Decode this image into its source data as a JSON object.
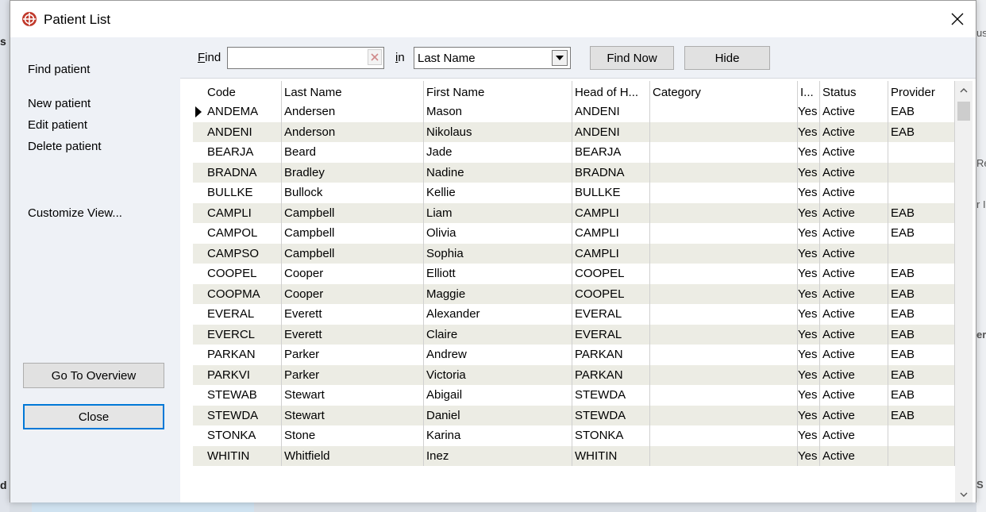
{
  "background": {
    "left_items": [
      "s",
      "d"
    ],
    "right_items": [
      "us",
      "Re",
      "r I",
      "er",
      "S"
    ]
  },
  "dialog": {
    "title": "Patient List"
  },
  "sidebar": {
    "find_patient": "Find patient",
    "new_patient": "New patient",
    "edit_patient": "Edit patient",
    "delete_patient": "Delete patient",
    "customize_view": "Customize View...",
    "go_to_overview": "Go To Overview",
    "close": "Close"
  },
  "findbar": {
    "find_label_u": "F",
    "find_label_rest": "ind",
    "find_value": "",
    "in_label_u": "i",
    "in_label_rest": "n",
    "in_selected": "Last Name",
    "find_now": "Find Now",
    "hide": "Hide"
  },
  "grid": {
    "columns": [
      "Code",
      "Last Name",
      "First Name",
      "Head of H...",
      "Category",
      "I...",
      "Status",
      "Provider"
    ],
    "rows": [
      [
        "ANDEMA",
        "Andersen",
        "Mason",
        "ANDENI",
        "",
        "Yes",
        "Active",
        "EAB"
      ],
      [
        "ANDENI",
        "Anderson",
        "Nikolaus",
        "ANDENI",
        "",
        "Yes",
        "Active",
        "EAB"
      ],
      [
        "BEARJA",
        "Beard",
        "Jade",
        "BEARJA",
        "",
        "Yes",
        "Active",
        ""
      ],
      [
        "BRADNA",
        "Bradley",
        "Nadine",
        "BRADNA",
        "",
        "Yes",
        "Active",
        ""
      ],
      [
        "BULLKE",
        "Bullock",
        "Kellie",
        "BULLKE",
        "",
        "Yes",
        "Active",
        ""
      ],
      [
        "CAMPLI",
        "Campbell",
        "Liam",
        "CAMPLI",
        "",
        "Yes",
        "Active",
        "EAB"
      ],
      [
        "CAMPOL",
        "Campbell",
        "Olivia",
        "CAMPLI",
        "",
        "Yes",
        "Active",
        "EAB"
      ],
      [
        "CAMPSO",
        "Campbell",
        "Sophia",
        "CAMPLI",
        "",
        "Yes",
        "Active",
        ""
      ],
      [
        "COOPEL",
        "Cooper",
        "Elliott",
        "COOPEL",
        "",
        "Yes",
        "Active",
        "EAB"
      ],
      [
        "COOPMA",
        "Cooper",
        "Maggie",
        "COOPEL",
        "",
        "Yes",
        "Active",
        "EAB"
      ],
      [
        "EVERAL",
        "Everett",
        "Alexander",
        "EVERAL",
        "",
        "Yes",
        "Active",
        "EAB"
      ],
      [
        "EVERCL",
        "Everett",
        "Claire",
        "EVERAL",
        "",
        "Yes",
        "Active",
        "EAB"
      ],
      [
        "PARKAN",
        "Parker",
        "Andrew",
        "PARKAN",
        "",
        "Yes",
        "Active",
        "EAB"
      ],
      [
        "PARKVI",
        "Parker",
        "Victoria",
        "PARKAN",
        "",
        "Yes",
        "Active",
        "EAB"
      ],
      [
        "STEWAB",
        "Stewart",
        "Abigail",
        "STEWDA",
        "",
        "Yes",
        "Active",
        "EAB"
      ],
      [
        "STEWDA",
        "Stewart",
        "Daniel",
        "STEWDA",
        "",
        "Yes",
        "Active",
        "EAB"
      ],
      [
        "STONKA",
        "Stone",
        "Karina",
        "STONKA",
        "",
        "Yes",
        "Active",
        ""
      ],
      [
        "WHITIN",
        "Whitfield",
        "Inez",
        "WHITIN",
        "",
        "Yes",
        "Active",
        ""
      ]
    ]
  },
  "colors": {
    "alt_row": "#ecece4",
    "sidebar_bg": "#eef1f6",
    "focus_border": "#0078d7",
    "sort_arrow": "#1a8f7a",
    "app_icon": "#c0392b"
  }
}
